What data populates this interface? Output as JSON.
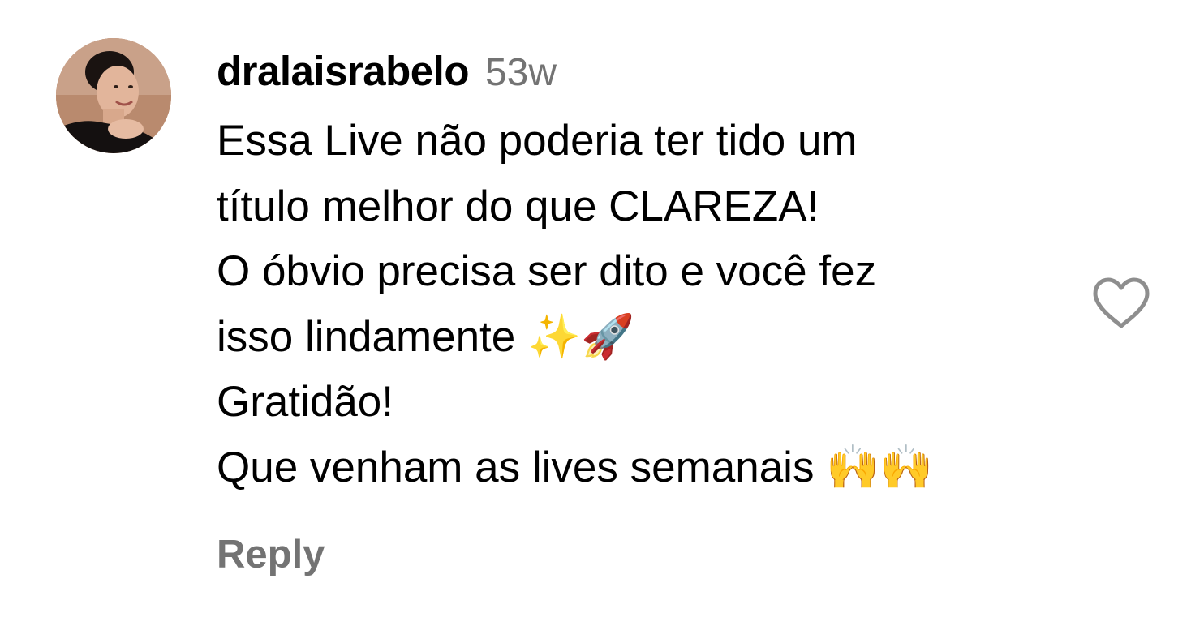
{
  "comment": {
    "username": "dralaisrabelo",
    "timestamp": "53w",
    "lines": [
      "Essa Live não poderia ter tido um",
      "título melhor do que CLAREZA!",
      "O óbvio precisa ser dito e você fez",
      "isso lindamente ✨🚀",
      "Gratidão!",
      "Que venham as lives semanais 🙌🙌"
    ],
    "reply_label": "Reply",
    "like_icon": "heart-outline-icon"
  },
  "colors": {
    "text": "#000000",
    "secondary_text": "#737373",
    "icon": "#8e8e8e",
    "background": "#ffffff"
  }
}
